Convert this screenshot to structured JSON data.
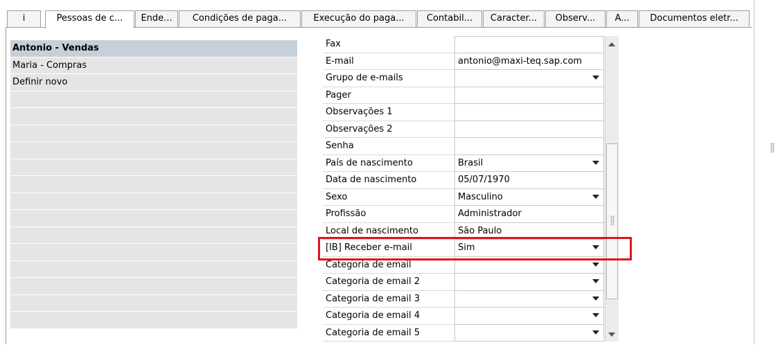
{
  "tabs": [
    {
      "label": "i"
    },
    {
      "label": "Pessoas de c..."
    },
    {
      "label": "Ende..."
    },
    {
      "label": "Condições de paga..."
    },
    {
      "label": "Execução do paga..."
    },
    {
      "label": "Contabil..."
    },
    {
      "label": "Caracter..."
    },
    {
      "label": "Observ..."
    },
    {
      "label": "A..."
    },
    {
      "label": "Documentos eletr..."
    }
  ],
  "active_tab": "Pessoas de c...",
  "contacts": [
    {
      "label": "Antonio - Vendas",
      "selected": true
    },
    {
      "label": "Maria - Compras"
    },
    {
      "label": "Definir novo"
    },
    {
      "label": ""
    },
    {
      "label": ""
    },
    {
      "label": ""
    },
    {
      "label": ""
    },
    {
      "label": ""
    },
    {
      "label": ""
    },
    {
      "label": ""
    },
    {
      "label": ""
    },
    {
      "label": ""
    },
    {
      "label": ""
    },
    {
      "label": ""
    },
    {
      "label": ""
    },
    {
      "label": ""
    },
    {
      "label": ""
    }
  ],
  "fields": [
    {
      "label": "Fax",
      "value": "",
      "dropdown": false
    },
    {
      "label": "E-mail",
      "value": "antonio@maxi-teq.sap.com",
      "dropdown": false
    },
    {
      "label": "Grupo de e-mails",
      "value": "",
      "dropdown": true
    },
    {
      "label": "Pager",
      "value": "",
      "dropdown": false
    },
    {
      "label": "Observações 1",
      "value": "",
      "dropdown": false
    },
    {
      "label": "Observações 2",
      "value": "",
      "dropdown": false
    },
    {
      "label": "Senha",
      "value": "",
      "dropdown": false
    },
    {
      "label": "País de nascimento",
      "value": "Brasil",
      "dropdown": true
    },
    {
      "label": "Data de nascimento",
      "value": "05/07/1970",
      "dropdown": false
    },
    {
      "label": "Sexo",
      "value": "Masculino",
      "dropdown": true
    },
    {
      "label": "Profissão",
      "value": "Administrador",
      "dropdown": false
    },
    {
      "label": "Local de nascimento",
      "value": "São Paulo",
      "dropdown": false
    },
    {
      "label": "[IB] Receber e-mail",
      "value": "Sim",
      "dropdown": true,
      "highlighted": true
    },
    {
      "label": "Categoria de email",
      "value": "",
      "dropdown": true
    },
    {
      "label": "Categoria de email 2",
      "value": "",
      "dropdown": true
    },
    {
      "label": "Categoria de email 3",
      "value": "",
      "dropdown": true
    },
    {
      "label": "Categoria de email 4",
      "value": "",
      "dropdown": true
    },
    {
      "label": "Categoria de email 5",
      "value": "",
      "dropdown": true
    }
  ],
  "colors": {
    "selected_row": "#c7cfd9",
    "list_row": "#e5e5e5",
    "highlight_border": "#e0141e"
  }
}
